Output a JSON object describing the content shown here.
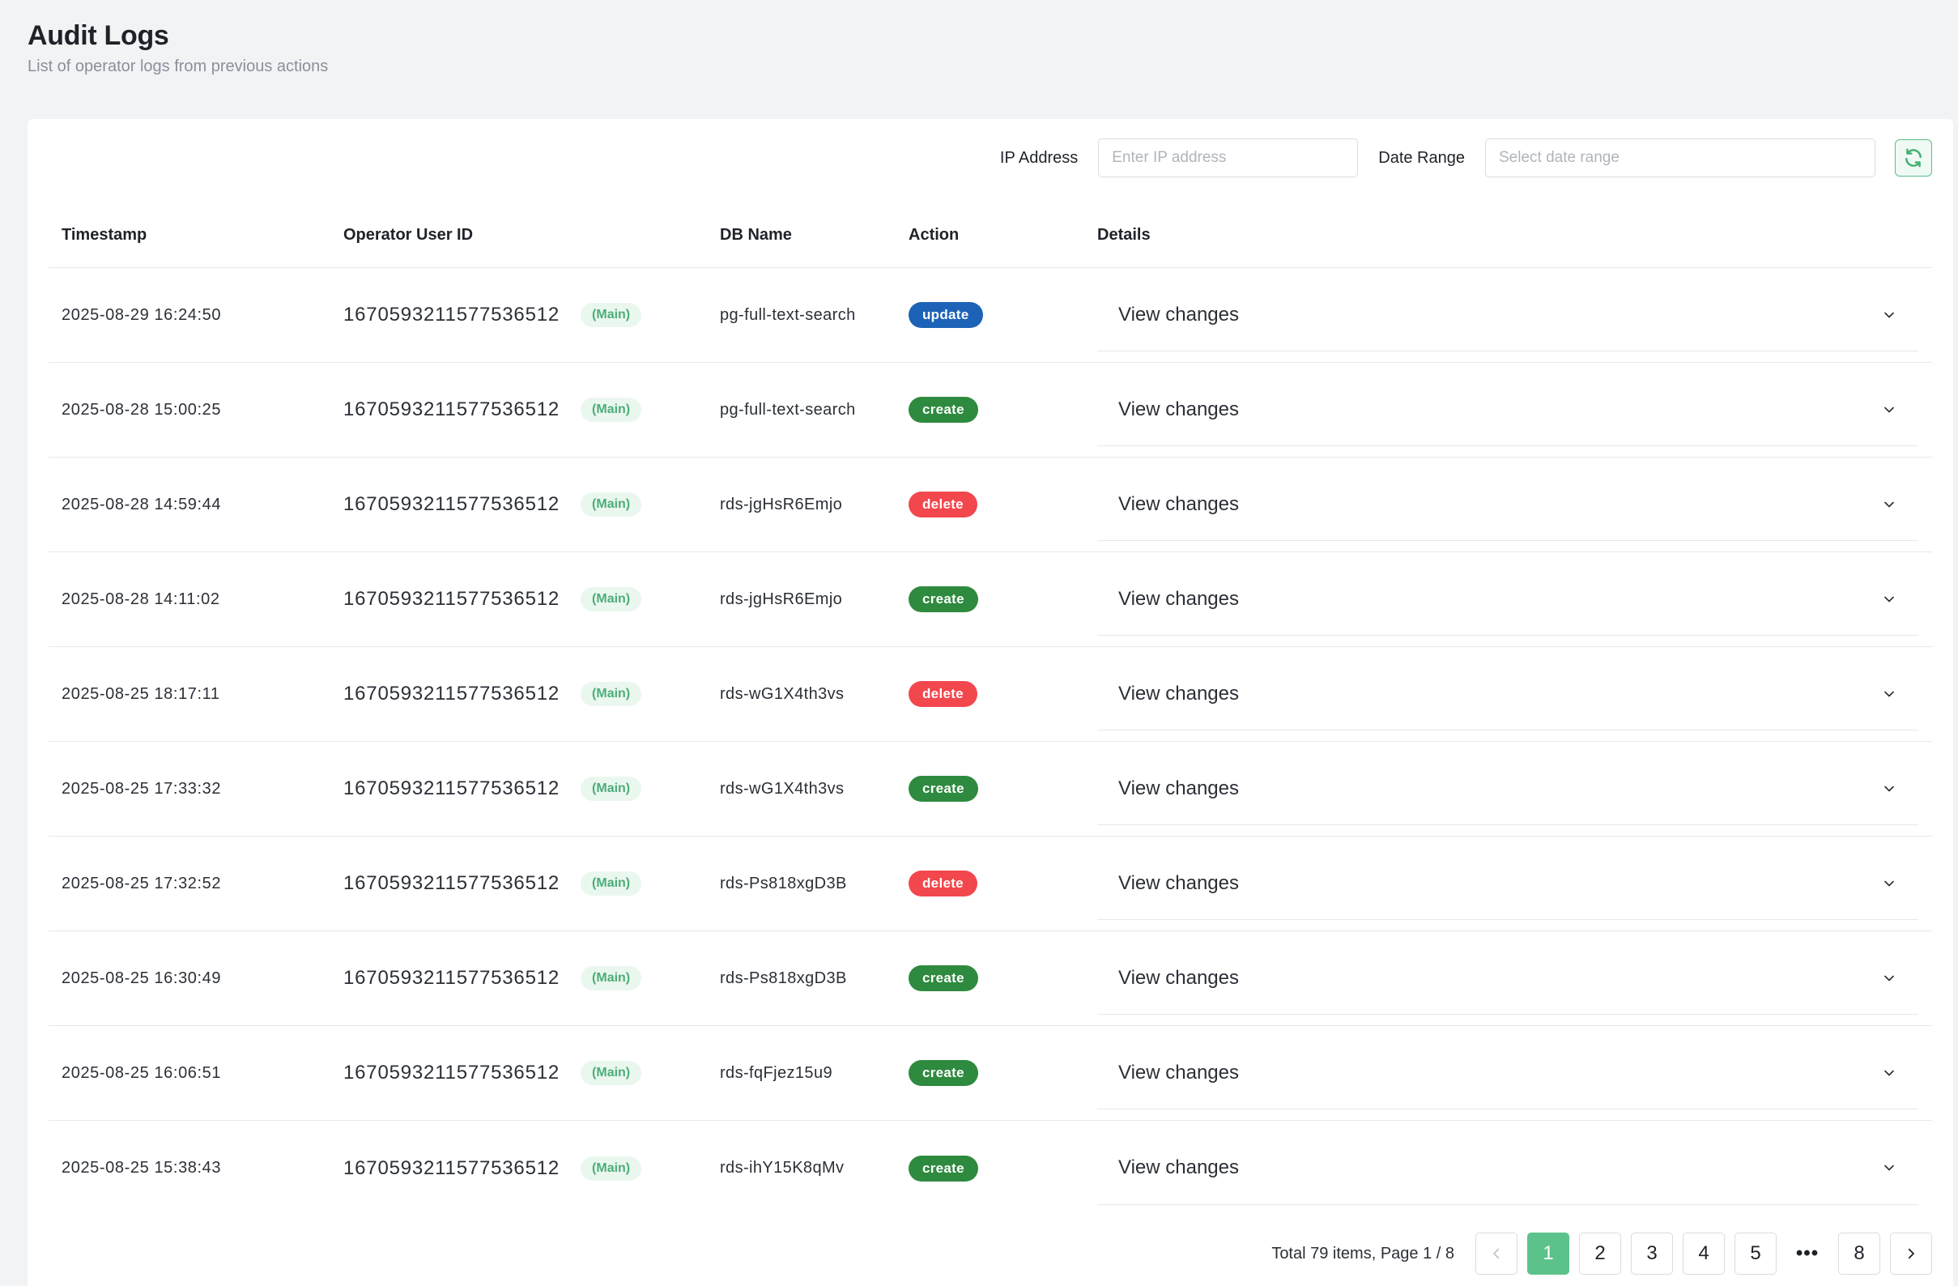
{
  "page": {
    "title": "Audit Logs",
    "subtitle": "List of operator logs from previous actions"
  },
  "filters": {
    "ip_label": "IP Address",
    "ip_placeholder": "Enter IP address",
    "date_label": "Date Range",
    "date_placeholder": "Select date range",
    "refresh_icon": "refresh-icon"
  },
  "table": {
    "columns": [
      "Timestamp",
      "Operator User ID",
      "DB Name",
      "Action",
      "Details"
    ],
    "details_label": "View changes",
    "rows": [
      {
        "timestamp": "2025-08-29 16:24:50",
        "operator_id": "1670593211577536512",
        "tag": "(Main)",
        "db_name": "pg-full-text-search",
        "action": "update"
      },
      {
        "timestamp": "2025-08-28 15:00:25",
        "operator_id": "1670593211577536512",
        "tag": "(Main)",
        "db_name": "pg-full-text-search",
        "action": "create"
      },
      {
        "timestamp": "2025-08-28 14:59:44",
        "operator_id": "1670593211577536512",
        "tag": "(Main)",
        "db_name": "rds-jgHsR6Emjo",
        "action": "delete"
      },
      {
        "timestamp": "2025-08-28 14:11:02",
        "operator_id": "1670593211577536512",
        "tag": "(Main)",
        "db_name": "rds-jgHsR6Emjo",
        "action": "create"
      },
      {
        "timestamp": "2025-08-25 18:17:11",
        "operator_id": "1670593211577536512",
        "tag": "(Main)",
        "db_name": "rds-wG1X4th3vs",
        "action": "delete"
      },
      {
        "timestamp": "2025-08-25 17:33:32",
        "operator_id": "1670593211577536512",
        "tag": "(Main)",
        "db_name": "rds-wG1X4th3vs",
        "action": "create"
      },
      {
        "timestamp": "2025-08-25 17:32:52",
        "operator_id": "1670593211577536512",
        "tag": "(Main)",
        "db_name": "rds-Ps818xgD3B",
        "action": "delete"
      },
      {
        "timestamp": "2025-08-25 16:30:49",
        "operator_id": "1670593211577536512",
        "tag": "(Main)",
        "db_name": "rds-Ps818xgD3B",
        "action": "create"
      },
      {
        "timestamp": "2025-08-25 16:06:51",
        "operator_id": "1670593211577536512",
        "tag": "(Main)",
        "db_name": "rds-fqFjez15u9",
        "action": "create"
      },
      {
        "timestamp": "2025-08-25 15:38:43",
        "operator_id": "1670593211577536512",
        "tag": "(Main)",
        "db_name": "rds-ihY15K8qMv",
        "action": "create"
      }
    ]
  },
  "pagination": {
    "summary": "Total 79 items, Page 1 / 8",
    "pages": [
      "1",
      "2",
      "3",
      "4",
      "5"
    ],
    "ellipsis": "•••",
    "last_page": "8",
    "current": "1",
    "prev_icon": "chevron-left-icon",
    "next_icon": "chevron-right-icon"
  },
  "colors": {
    "accent": "#5cc28b",
    "update": "#1c63b7",
    "create": "#2e8a3e",
    "delete": "#f2474d"
  }
}
